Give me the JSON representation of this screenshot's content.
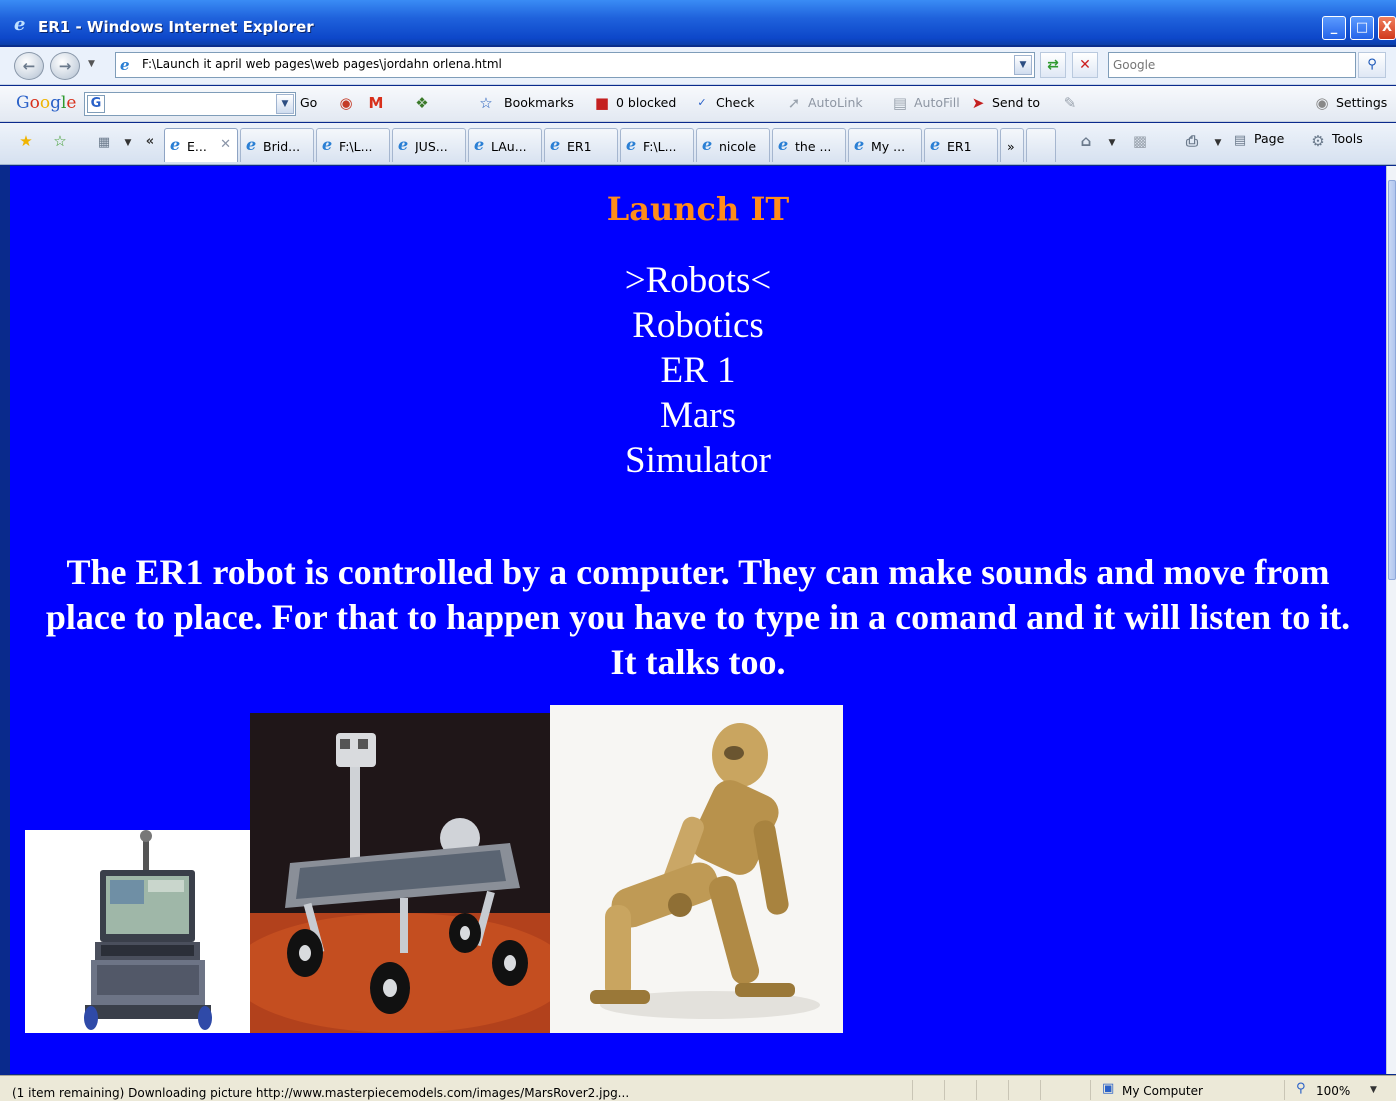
{
  "window": {
    "title": "ER1 - Windows Internet Explorer",
    "buttons": [
      "_",
      "□",
      "X"
    ]
  },
  "address_bar": {
    "url": "F:\\Launch it april web pages\\web pages\\jordahn orlena.html",
    "search_placeholder": "Google"
  },
  "google_toolbar": {
    "logo": "Google",
    "go_label": "Go",
    "bookmarks_label": "Bookmarks",
    "blocked_label": "0 blocked",
    "check_label": "Check",
    "autolink_label": "AutoLink",
    "autofill_label": "AutoFill",
    "sendto_label": "Send to",
    "settings_label": "Settings"
  },
  "tabs": [
    {
      "label": "E...",
      "active": true
    },
    {
      "label": "Brid..."
    },
    {
      "label": "F:\\L..."
    },
    {
      "label": "JUS..."
    },
    {
      "label": "LAu..."
    },
    {
      "label": "ER1"
    },
    {
      "label": "F:\\L..."
    },
    {
      "label": "nicole"
    },
    {
      "label": "the ..."
    },
    {
      "label": "My ..."
    },
    {
      "label": "ER1"
    }
  ],
  "command_bar": {
    "more_label": "»",
    "page_label": "Page",
    "tools_label": "Tools"
  },
  "page": {
    "title": "Launch IT",
    "nav": [
      ">Robots<",
      "Robotics",
      "ER 1",
      "Mars",
      "Simulator"
    ],
    "paragraph": "The ER1 robot is controlled by a computer. They can make sounds and move from place to place. For that to happen you have to type in a comand and it will listen to it. It talks too.",
    "bg_color": "#0000ff",
    "title_color": "#ff8c1a"
  },
  "status_bar": {
    "text": "(1 item remaining) Downloading picture http://www.masterpiecemodels.com/images/MarsRover2.jpg...",
    "zone": "My Computer",
    "zoom": "100%"
  }
}
